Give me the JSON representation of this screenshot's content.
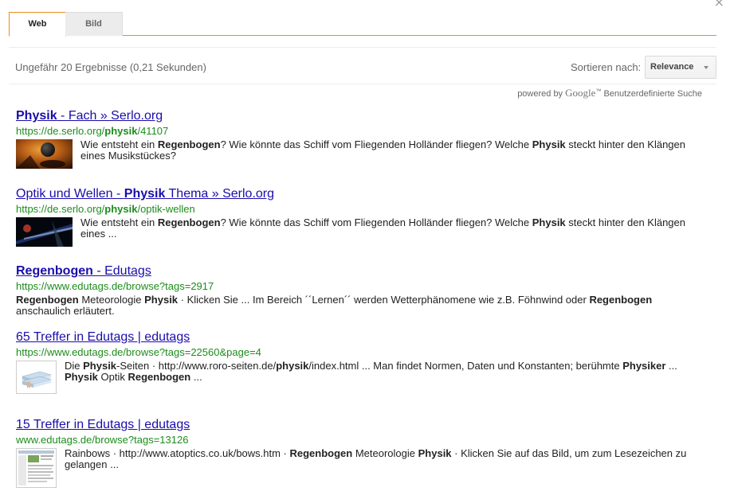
{
  "close_label": "×",
  "tabs": [
    {
      "label": "Web",
      "active": true
    },
    {
      "label": "Bild",
      "active": false
    }
  ],
  "info": {
    "result_count": "Ungefähr 20 Ergebnisse (0,21 Sekunden)",
    "sort_label": "Sortieren nach:",
    "sort_value": "Relevance",
    "powered_prefix": "powered by",
    "powered_brand": "Google",
    "powered_tm": "™",
    "powered_suffix": "Benutzerdefinierte Suche"
  },
  "results": [
    {
      "title": [
        {
          "t": "Physik",
          "b": true
        },
        {
          "t": " - Fach » Serlo.org",
          "b": false
        }
      ],
      "url": [
        {
          "t": "https://de.serlo.org/",
          "b": false
        },
        {
          "t": "physik",
          "b": true
        },
        {
          "t": "/41107",
          "b": false
        }
      ],
      "thumbnail": "planet-image",
      "snippet": [
        {
          "t": "Wie entsteht ein ",
          "b": false
        },
        {
          "t": "Regenbogen",
          "b": true
        },
        {
          "t": "? Wie könnte das Schiff vom Fliegenden Holländer fliegen? Welche ",
          "b": false
        },
        {
          "t": "Physik",
          "b": true
        },
        {
          "t": " steckt hinter den Klängen eines Musikstückes?",
          "b": false
        }
      ]
    },
    {
      "title": [
        {
          "t": "Optik und Wellen - ",
          "b": false
        },
        {
          "t": "Physik",
          "b": true
        },
        {
          "t": " Thema » Serlo.org",
          "b": false
        }
      ],
      "url": [
        {
          "t": "https://de.serlo.org/",
          "b": false
        },
        {
          "t": "physik",
          "b": true
        },
        {
          "t": "/optik-wellen",
          "b": false
        }
      ],
      "thumbnail": "light-beam-image",
      "snippet": [
        {
          "t": "Wie entsteht ein ",
          "b": false
        },
        {
          "t": "Regenbogen",
          "b": true
        },
        {
          "t": "? Wie könnte das Schiff vom Fliegenden Holländer fliegen? Welche ",
          "b": false
        },
        {
          "t": "Physik",
          "b": true
        },
        {
          "t": " steckt hinter den Klängen eines ...",
          "b": false
        }
      ]
    },
    {
      "title": [
        {
          "t": "Regenbogen",
          "b": true
        },
        {
          "t": " - Edutags",
          "b": false
        }
      ],
      "url": [
        {
          "t": "https://www.edutags.de/browse?tags=2917",
          "b": false
        }
      ],
      "thumbnail": "",
      "snippet": [
        {
          "t": "Regenbogen",
          "b": true
        },
        {
          "t": " Meteorologie ",
          "b": false
        },
        {
          "t": "Physik",
          "b": true
        },
        {
          "t": " · Klicken Sie ... Im Bereich ´´Lernen´´ werden Wetterphänomene wie z.B. Föhnwind oder ",
          "b": false
        },
        {
          "t": "Regenbogen",
          "b": true
        },
        {
          "t": " anschaulich erläutert.",
          "b": false
        }
      ]
    },
    {
      "title": [
        {
          "t": "65 Treffer in Edutags | edutags",
          "b": false
        }
      ],
      "url": [
        {
          "t": "https://www.edutags.de/browse?tags=22560&page=4",
          "b": false
        }
      ],
      "thumbnail": "books-icon",
      "snippet": [
        {
          "t": "Die ",
          "b": false
        },
        {
          "t": "Physik",
          "b": true
        },
        {
          "t": "-Seiten · http://www.roro-seiten.de/",
          "b": false
        },
        {
          "t": "physik",
          "b": true
        },
        {
          "t": "/index.html ... Man findet Normen, Daten und Konstanten; berühmte ",
          "b": false
        },
        {
          "t": "Physiker",
          "b": true
        },
        {
          "t": " ... ",
          "b": false
        },
        {
          "t": "Physik",
          "b": true
        },
        {
          "t": " Optik ",
          "b": false
        },
        {
          "t": "Regenbogen",
          "b": true
        },
        {
          "t": "  ...",
          "b": false
        }
      ]
    },
    {
      "title": [
        {
          "t": "15 Treffer in Edutags | edutags",
          "b": false
        }
      ],
      "url": [
        {
          "t": "www.edutags.de/browse?tags=13126",
          "b": false
        }
      ],
      "thumbnail": "webpage-screenshot",
      "snippet": [
        {
          "t": "Rainbows · http://www.atoptics.co.uk/bows.htm · ",
          "b": false
        },
        {
          "t": "Regenbogen",
          "b": true
        },
        {
          "t": " Meteorologie ",
          "b": false
        },
        {
          "t": "Physik",
          "b": true
        },
        {
          "t": " · Klicken Sie auf das Bild, um zum Lesezeichen zu gelangen ...",
          "b": false
        }
      ]
    }
  ]
}
